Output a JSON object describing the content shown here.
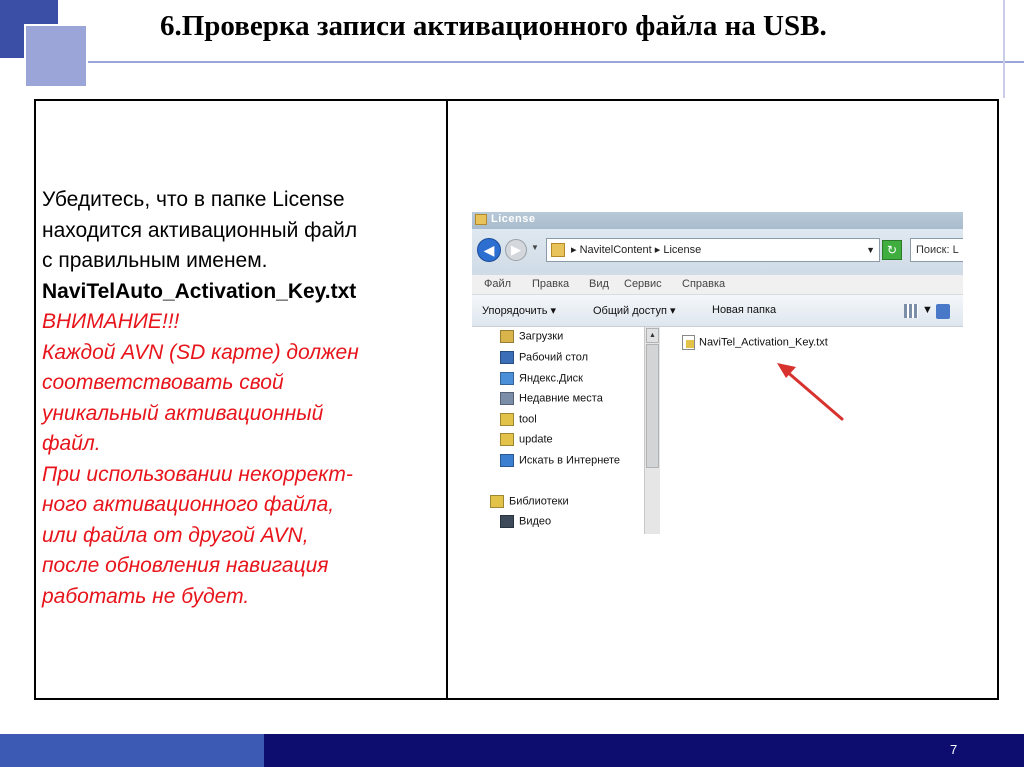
{
  "slide": {
    "title": "6.Проверка записи активационного файла на USB.",
    "page_number": "7"
  },
  "text": {
    "line1": "Убедитесь, что в папке License",
    "line2": "находится активационный файл",
    "line3": "с правильным именем.",
    "filename": "NaviTelAuto_Activation_Key.txt",
    "warning_title": "ВНИМАНИЕ!!!",
    "warn1": "Каждой AVN (SD карте) должен",
    "warn2": "соответствовать свой",
    "warn3": "уникальный активационный",
    "warn4": "файл.",
    "warn5": "При использовании некоррект-",
    "warn6": "ного активационного файла,",
    "warn7": "или файла от другой AVN,",
    "warn8": "после обновления навигация",
    "warn9": "работать не будет."
  },
  "explorer": {
    "window_title": "License",
    "address_path": "▸ NavitelContent ▸ License",
    "search_placeholder": "Поиск: L",
    "menu": [
      "Файл",
      "Правка",
      "Вид",
      "Сервис",
      "Справка"
    ],
    "commands": [
      "Упорядочить ▾",
      "Общий доступ ▾",
      "Новая папка"
    ],
    "nav_items": [
      {
        "label": "Загрузки",
        "icon": "downloads-folder-icon",
        "color": "#d9b44a"
      },
      {
        "label": "Рабочий стол",
        "icon": "desktop-icon",
        "color": "#3a6fb8"
      },
      {
        "label": "Яндекс.Диск",
        "icon": "yandex-disk-icon",
        "color": "#4a8fd8"
      },
      {
        "label": "Недавние места",
        "icon": "recent-places-icon",
        "color": "#7a8ea8"
      },
      {
        "label": "tool",
        "icon": "folder-icon",
        "color": "#e3c24a"
      },
      {
        "label": "update",
        "icon": "folder-icon",
        "color": "#e3c24a"
      },
      {
        "label": "Искать в Интернете",
        "icon": "web-search-icon",
        "color": "#3a7fd0"
      },
      {
        "label": "Библиотеки",
        "icon": "libraries-icon",
        "color": "#e3c24a"
      },
      {
        "label": "Видео",
        "icon": "video-icon",
        "color": "#3c4a5a"
      }
    ],
    "file_name": "NaviTel_Activation_Key.txt"
  },
  "colors": {
    "accent_dark": "#0d0d70",
    "accent_light": "#3c59b3",
    "warning_red": "#e8141b",
    "arrow_red": "#d8322e"
  }
}
